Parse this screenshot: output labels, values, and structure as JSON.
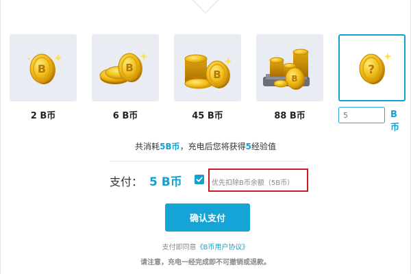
{
  "packages": [
    {
      "label": "2 B币",
      "icon": "single-coin-icon"
    },
    {
      "label": "6 B币",
      "icon": "coin-stack-small-icon"
    },
    {
      "label": "45 B币",
      "icon": "coin-pile-icon"
    },
    {
      "label": "88 B币",
      "icon": "coin-cart-icon"
    }
  ],
  "custom": {
    "icon": "question-coin-icon",
    "placeholder": "5",
    "unit": "B币",
    "selected": true
  },
  "summary": {
    "prefix": "共消耗",
    "cost": "5B币",
    "middle": "，充电后您将获得",
    "exp": "5",
    "suffix": "经验值"
  },
  "payment": {
    "label": "支付：",
    "amount": "5 B币",
    "deduct_checked": true,
    "deduct_text": "优先扣除B币余额（5B币）"
  },
  "confirm_button": "确认支付",
  "agreement": {
    "prefix": "支付即同意",
    "link": "《B币用户协议》"
  },
  "notice": "请注意，充电一经完成即不可撤销或退款。",
  "colors": {
    "accent": "#13a0cf",
    "button": "#16a3d5",
    "highlight_box": "#c9181f",
    "tile_bg": "#e9ecf3",
    "coin_gold": "#f2bf1b"
  }
}
